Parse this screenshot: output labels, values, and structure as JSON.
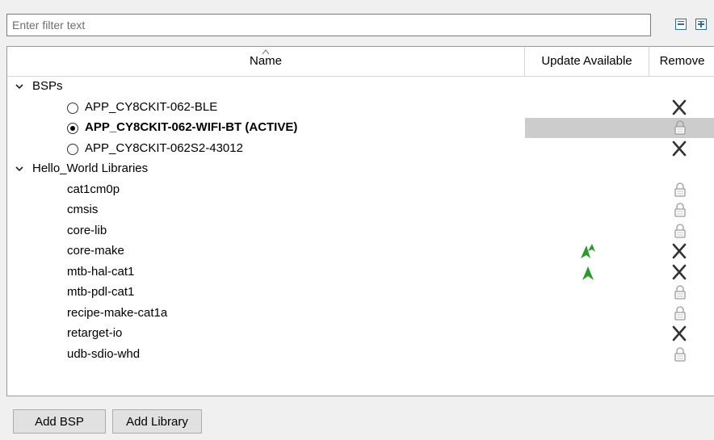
{
  "filter": {
    "placeholder": "Enter filter text",
    "value": ""
  },
  "toolbar": {
    "collapse_all_icon": "collapse-all-icon",
    "expand_all_icon": "expand-all-icon"
  },
  "columns": {
    "name": "Name",
    "update_available": "Update Available",
    "remove": "Remove"
  },
  "groups": [
    {
      "label": "BSPs",
      "expanded": true,
      "items": [
        {
          "label": "APP_CY8CKIT-062-BLE",
          "selected": false,
          "update": false,
          "remove_icon": "remove-x-icon"
        },
        {
          "label": "APP_CY8CKIT-062-WIFI-BT (ACTIVE)",
          "selected": true,
          "update": false,
          "remove_icon": "lock-icon"
        },
        {
          "label": "APP_CY8CKIT-062S2-43012",
          "selected": false,
          "update": false,
          "remove_icon": "remove-x-icon"
        }
      ]
    },
    {
      "label": "Hello_World Libraries",
      "expanded": true,
      "items": [
        {
          "label": "cat1cm0p",
          "update": false,
          "remove_icon": "lock-icon"
        },
        {
          "label": "cmsis",
          "update": false,
          "remove_icon": "lock-icon"
        },
        {
          "label": "core-lib",
          "update": false,
          "remove_icon": "lock-icon"
        },
        {
          "label": "core-make",
          "update": "major",
          "remove_icon": "remove-x-icon"
        },
        {
          "label": "mtb-hal-cat1",
          "update": "minor",
          "remove_icon": "remove-x-icon"
        },
        {
          "label": "mtb-pdl-cat1",
          "update": false,
          "remove_icon": "lock-icon"
        },
        {
          "label": "recipe-make-cat1a",
          "update": false,
          "remove_icon": "lock-icon"
        },
        {
          "label": "retarget-io",
          "update": false,
          "remove_icon": "remove-x-icon"
        },
        {
          "label": "udb-sdio-whd",
          "update": false,
          "remove_icon": "lock-icon"
        }
      ]
    }
  ],
  "buttons": {
    "add_bsp": "Add BSP",
    "add_library": "Add Library"
  },
  "colors": {
    "update_green": "#2a9a2a",
    "active_row_bg": "#cccccc",
    "icon_blue": "#2e6da4"
  }
}
